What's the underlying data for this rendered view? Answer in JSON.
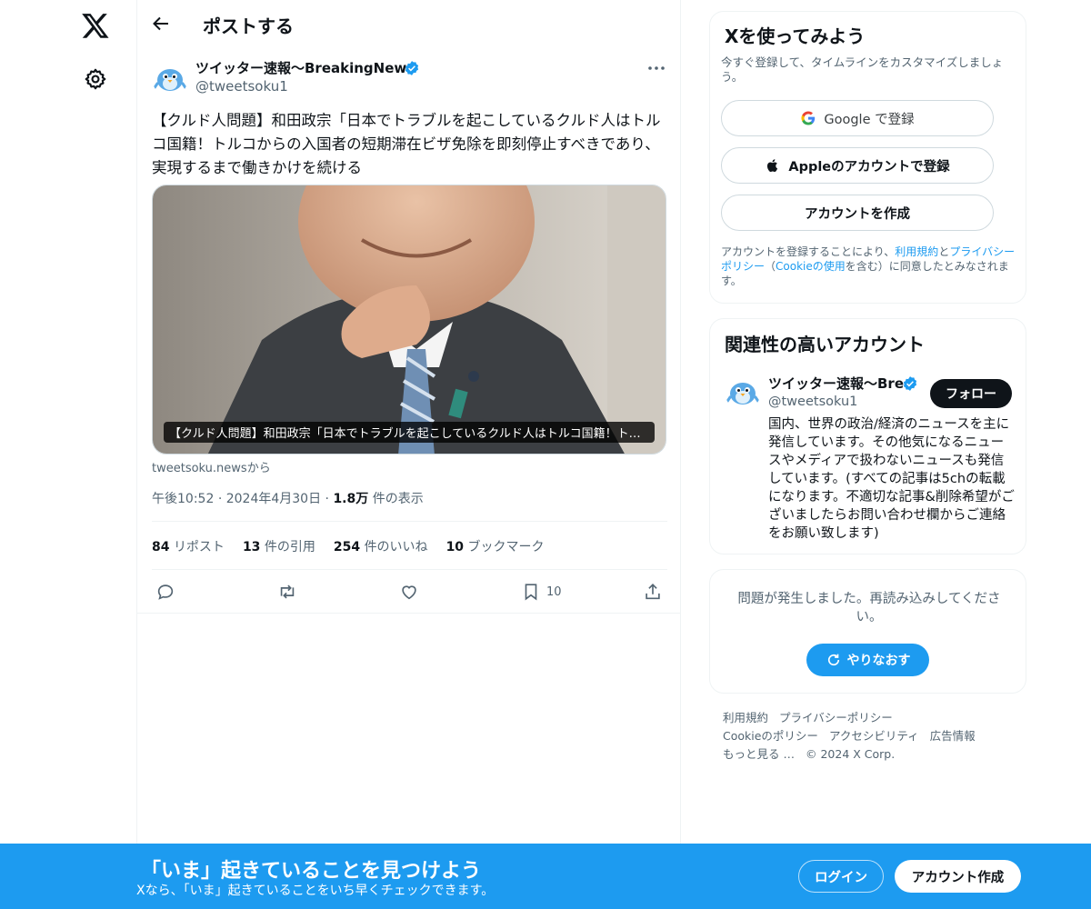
{
  "header": {
    "title": "ポストする"
  },
  "post": {
    "author_name": "ツイッター速報〜BreakingNews",
    "author_handle": "@tweetsoku1",
    "text": "【クルド人問題】和田政宗「日本でトラブルを起こしているクルド人はトルコ国籍！トルコからの入国者の短期滞在ビザ免除を即刻停止すべきであり、実現するまで働きかけを続ける",
    "media_caption": "【クルド人問題】和田政宗「日本でトラブルを起こしているクルド人はトルコ国籍！トル...",
    "media_source": "tweetsoku.newsから",
    "time": "午後10:52",
    "date": "2024年4月30日",
    "views_count": "1.8万",
    "views_label": "件の表示",
    "stats": {
      "reposts_count": "84",
      "reposts_label": "リポスト",
      "quotes_count": "13",
      "quotes_label": "件の引用",
      "likes_count": "254",
      "likes_label": "件のいいね",
      "bookmarks_count": "10",
      "bookmarks_label": "ブックマーク"
    },
    "bookmark_action_count": "10"
  },
  "signup": {
    "title": "Xを使ってみよう",
    "subtitle": "今すぐ登録して、タイムラインをカスタマイズしましょう。",
    "google_label": "Google で登録",
    "apple_label": "Appleのアカウントで登録",
    "create_label": "アカウントを作成",
    "terms_prefix": "アカウントを登録することにより、",
    "terms_link": "利用規約",
    "terms_and": "と",
    "privacy_link": "プライバシーポリシー",
    "cookie_open": "（",
    "cookie_link": "Cookieの使用",
    "cookie_close": "を含む）に同意したとみなされます。"
  },
  "related": {
    "title": "関連性の高いアカウント",
    "name": "ツイッター速報〜Bre",
    "handle": "@tweetsoku1",
    "follow_label": "フォロー",
    "bio": "国内、世界の政治/経済のニュースを主に発信しています。その他気になるニュースやメディアで扱わないニュースも発信しています。(すべての記事は5chの転載になります。不適切な記事&削除希望がございましたらお問い合わせ欄からご連絡をお願い致します)"
  },
  "error": {
    "message": "問題が発生しました。再読み込みしてください。",
    "retry_label": "やりなおす"
  },
  "footer": {
    "terms": "利用規約",
    "privacy": "プライバシーポリシー",
    "cookie": "Cookieのポリシー",
    "accessibility": "アクセシビリティ",
    "ads": "広告情報",
    "more": "もっと見る …",
    "copyright": "© 2024 X Corp."
  },
  "bottom_bar": {
    "title": "「いま」起きていることを見つけよう",
    "subtitle": "Xなら、「いま」起きていることをいち早くチェックできます。",
    "login_label": "ログイン",
    "create_label": "アカウント作成"
  },
  "colors": {
    "accent": "#1d9bf0",
    "text_primary": "#0f1419",
    "text_secondary": "#536471",
    "border": "#eff3f4"
  },
  "icons": [
    "x-logo-icon",
    "gear-icon",
    "back-arrow-icon",
    "verified-icon",
    "more-icon",
    "reply-icon",
    "repost-icon",
    "like-icon",
    "bookmark-icon",
    "share-icon",
    "google-icon",
    "apple-icon",
    "refresh-icon"
  ]
}
